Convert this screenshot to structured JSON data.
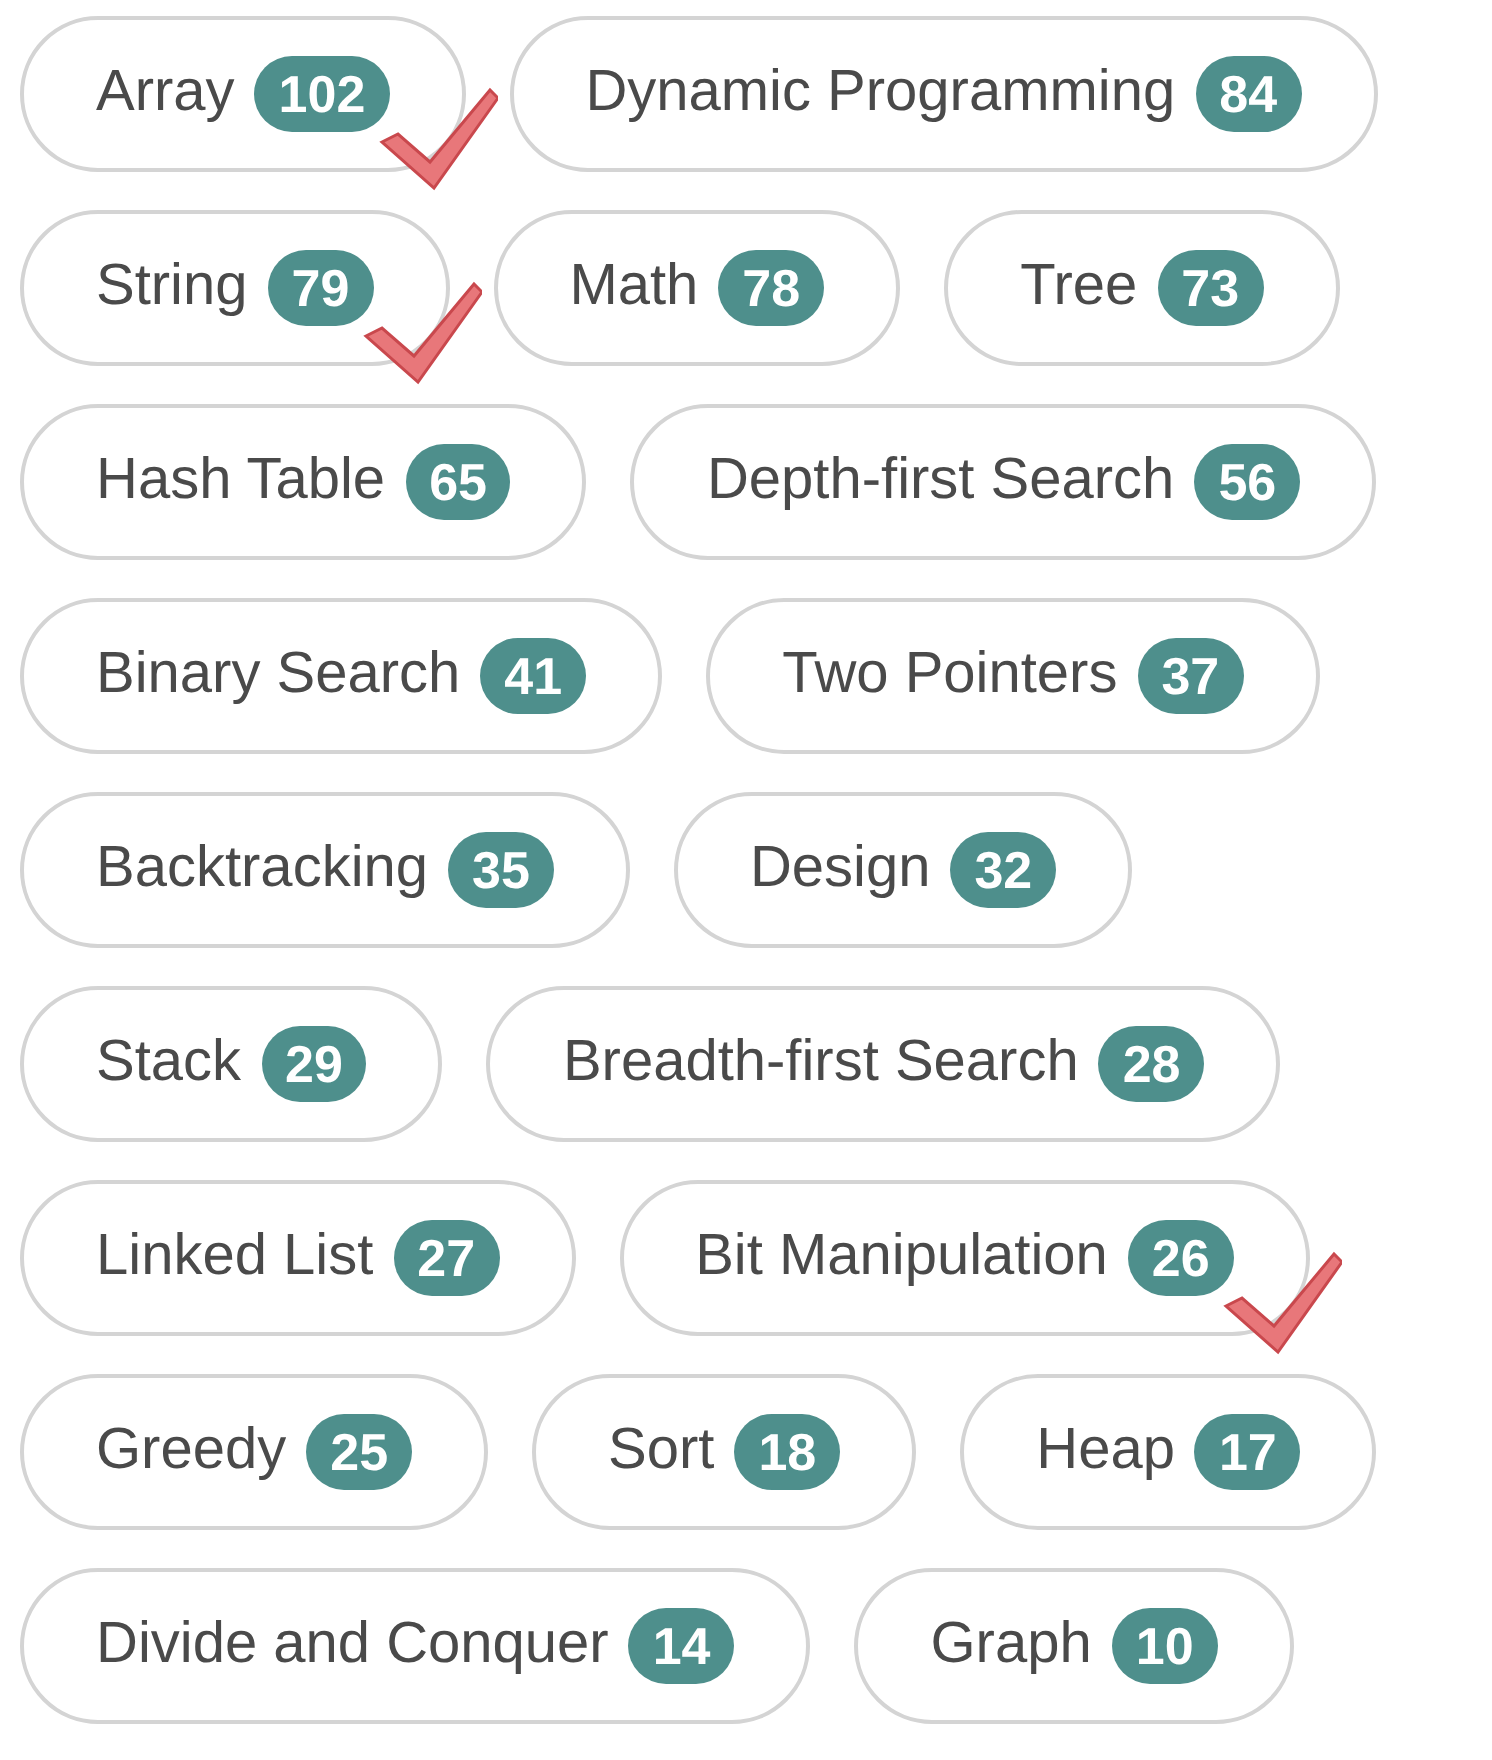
{
  "tag_rows": [
    [
      {
        "label": "Array",
        "count": "102",
        "marked": true
      },
      {
        "label": "Dynamic Programming",
        "count": "84",
        "marked": false
      }
    ],
    [
      {
        "label": "String",
        "count": "79",
        "marked": true
      },
      {
        "label": "Math",
        "count": "78",
        "marked": false
      },
      {
        "label": "Tree",
        "count": "73",
        "marked": false
      }
    ],
    [
      {
        "label": "Hash Table",
        "count": "65",
        "marked": false
      },
      {
        "label": "Depth-first Search",
        "count": "56",
        "marked": false
      }
    ],
    [
      {
        "label": "Binary Search",
        "count": "41",
        "marked": false
      },
      {
        "label": "Two Pointers",
        "count": "37",
        "marked": false
      }
    ],
    [
      {
        "label": "Backtracking",
        "count": "35",
        "marked": false
      },
      {
        "label": "Design",
        "count": "32",
        "marked": false
      }
    ],
    [
      {
        "label": "Stack",
        "count": "29",
        "marked": false
      },
      {
        "label": "Breadth-first Search",
        "count": "28",
        "marked": false
      }
    ],
    [
      {
        "label": "Linked List",
        "count": "27",
        "marked": false
      },
      {
        "label": "Bit Manipulation",
        "count": "26",
        "marked": true
      }
    ],
    [
      {
        "label": "Greedy",
        "count": "25",
        "marked": false
      },
      {
        "label": "Sort",
        "count": "18",
        "marked": false
      },
      {
        "label": "Heap",
        "count": "17",
        "marked": false
      }
    ],
    [
      {
        "label": "Divide and Conquer",
        "count": "14",
        "marked": false
      },
      {
        "label": "Graph",
        "count": "10",
        "marked": false
      }
    ]
  ]
}
